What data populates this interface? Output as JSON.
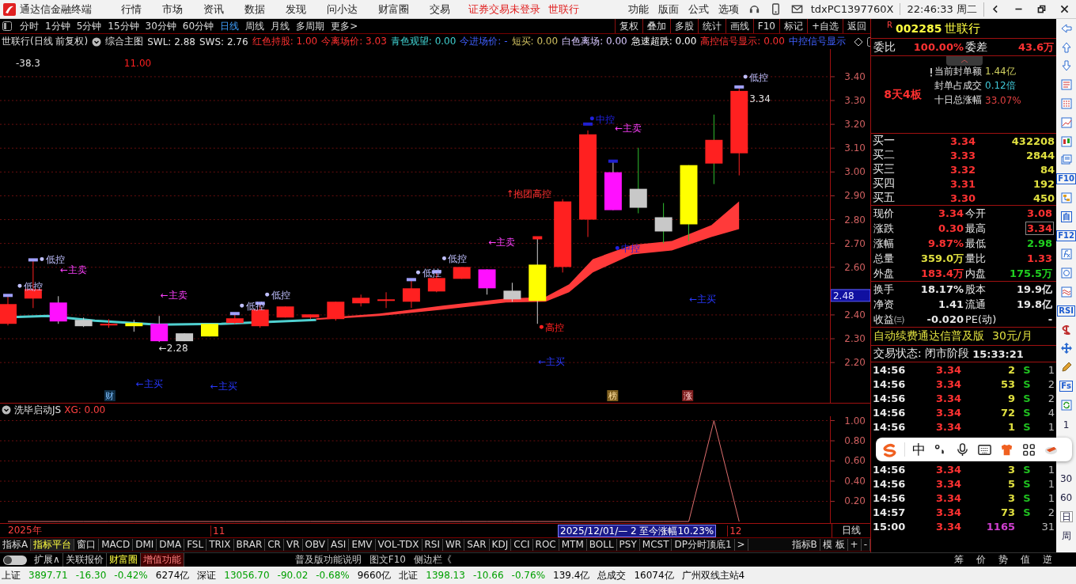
{
  "title_bar": {
    "app_name": "通达信金融终端",
    "menus": [
      "行情",
      "市场",
      "资讯",
      "数据",
      "发现",
      "问小达",
      "财富圈",
      "交易"
    ],
    "notice": "证券交易未登录",
    "notice_stock": "世联行",
    "right_menus": [
      "功能",
      "版面",
      "公式",
      "选项"
    ],
    "user_id": "tdxPC1397760X",
    "clock": "22:46:33 周二"
  },
  "period_tabs": [
    {
      "label": "分时",
      "selected": false
    },
    {
      "label": "1分钟",
      "selected": false
    },
    {
      "label": "5分钟",
      "selected": false
    },
    {
      "label": "15分钟",
      "selected": false
    },
    {
      "label": "30分钟",
      "selected": false
    },
    {
      "label": "60分钟",
      "selected": false
    },
    {
      "label": "日线",
      "selected": true
    },
    {
      "label": "周线",
      "selected": false
    },
    {
      "label": "月线",
      "selected": false
    },
    {
      "label": "多周期",
      "selected": false
    },
    {
      "label": "更多>",
      "selected": false
    }
  ],
  "chart_buttons": [
    "复权",
    "叠加",
    "多股",
    "统计",
    "画线",
    "F10",
    "标记",
    "+自选",
    "返回"
  ],
  "info_line": {
    "title": "世联行(日线 前复权)",
    "indicator": "综合主图",
    "items": [
      {
        "text": "SWL: 2.88",
        "kind": "plain"
      },
      {
        "text": "SWS: 2.76",
        "kind": "plain"
      },
      {
        "text": "红色持股: 1.00",
        "kind": "red"
      },
      {
        "text": "今离场价: 3.03",
        "kind": "red"
      },
      {
        "text": "青色观望: 0.00",
        "kind": "cyan"
      },
      {
        "text": "今进场价: -",
        "kind": "blue"
      },
      {
        "text": "短买: 0.00",
        "kind": "tan"
      },
      {
        "text": "白色离场: 0.00",
        "kind": "lavender"
      },
      {
        "text": "急速超跌: 0.00",
        "kind": "white"
      },
      {
        "text": "高控信号显示: 0.00",
        "kind": "red"
      },
      {
        "text": "中控信号显示",
        "kind": "blue"
      }
    ]
  },
  "main_chart": {
    "header_values": [
      "-38.3",
      "11.00"
    ],
    "y_labels": [
      "3.40",
      "3.30",
      "3.20",
      "3.10",
      "3.00",
      "2.90",
      "2.80",
      "2.70",
      "2.60",
      "2.40",
      "2.30",
      "2.20"
    ],
    "price_tag": "2.48",
    "annotations": [
      {
        "text": "低控",
        "kind": "low"
      },
      {
        "text": "低控",
        "kind": "low"
      },
      {
        "text": "←主卖",
        "kind": "sell"
      },
      {
        "text": "←主卖",
        "kind": "sell"
      },
      {
        "text": "←2.28",
        "kind": "price"
      },
      {
        "text": "←主买",
        "kind": "buy"
      },
      {
        "text": "←主买",
        "kind": "buy"
      },
      {
        "text": "低控",
        "kind": "low"
      },
      {
        "text": "低控",
        "kind": "low"
      },
      {
        "text": "低控",
        "kind": "low"
      },
      {
        "text": "低控",
        "kind": "low"
      },
      {
        "text": "←主卖",
        "kind": "sell"
      },
      {
        "text": "高控",
        "kind": "high"
      },
      {
        "text": "←主买",
        "kind": "buy"
      },
      {
        "text": "↑抱团高控",
        "kind": "hug"
      },
      {
        "text": "中控",
        "kind": "mid"
      },
      {
        "text": "←主卖",
        "kind": "sell"
      },
      {
        "text": "中控",
        "kind": "mid"
      },
      {
        "text": "←主买",
        "kind": "buy"
      },
      {
        "text": "低控",
        "kind": "low"
      },
      {
        "text": "3.34",
        "kind": "price"
      }
    ],
    "markers": [
      {
        "text": "财",
        "kind": "finance"
      },
      {
        "text": "榜",
        "kind": "rank"
      },
      {
        "text": "涨",
        "kind": "rise"
      }
    ]
  },
  "indicator": {
    "name": "洗毕启动JS",
    "reading": "XG: 0.00",
    "chart_data": {
      "type": "line",
      "grid": true,
      "ylim": [
        0,
        1.02
      ],
      "yticks": [
        {
          "value": 0.2,
          "label": "0.20"
        },
        {
          "value": 0.4,
          "label": "0.40"
        },
        {
          "value": 0.6,
          "label": "0.60"
        },
        {
          "value": 0.8,
          "label": "0.80"
        },
        {
          "value": 1.0,
          "label": "1.00"
        }
      ],
      "series": [
        {
          "color": "#e07070",
          "values": [
            0,
            0,
            0,
            0,
            0,
            0,
            0,
            0,
            0,
            0,
            0,
            0,
            0,
            0,
            0,
            0,
            0,
            0,
            0,
            0,
            0,
            0,
            0,
            0,
            0,
            0,
            0,
            0,
            1,
            0
          ]
        }
      ]
    }
  },
  "date_axis": {
    "year": "2025年",
    "month_1": "11",
    "range": "2025/12/01/— 2 至今涨幅10.23%",
    "month_2": "12",
    "period": "日线"
  },
  "indicator_tabs": [
    {
      "label": "指标A",
      "selected": false
    },
    {
      "label": "指标平台",
      "selected": true
    },
    {
      "label": "窗口",
      "selected": false
    },
    {
      "label": "MACD",
      "selected": false
    },
    {
      "label": "DMI",
      "selected": false
    },
    {
      "label": "DMA",
      "selected": false
    },
    {
      "label": "FSL",
      "selected": false
    },
    {
      "label": "TRIX",
      "selected": false
    },
    {
      "label": "BRAR",
      "selected": false
    },
    {
      "label": "CR",
      "selected": false
    },
    {
      "label": "VR",
      "selected": false
    },
    {
      "label": "OBV",
      "selected": false
    },
    {
      "label": "ASI",
      "selected": false
    },
    {
      "label": "EMV",
      "selected": false
    },
    {
      "label": "VOL-TDX",
      "selected": false
    },
    {
      "label": "RSI",
      "selected": false
    },
    {
      "label": "WR",
      "selected": false
    },
    {
      "label": "SAR",
      "selected": false
    },
    {
      "label": "KDJ",
      "selected": false
    },
    {
      "label": "CCI",
      "selected": false
    },
    {
      "label": "ROC",
      "selected": false
    },
    {
      "label": "MTM",
      "selected": false
    },
    {
      "label": "BOLL",
      "selected": false
    },
    {
      "label": "PSY",
      "selected": false
    },
    {
      "label": "MCST",
      "selected": false
    },
    {
      "label": "DP分时顶底1",
      "selected": false
    }
  ],
  "indicator_tabs_right": [
    "指标B",
    "模 板",
    "+",
    "-"
  ],
  "scroll_arrow": ">",
  "extra_bar": {
    "toggle_on": false,
    "buttons": [
      {
        "label": "扩展∧",
        "kind": "plain"
      },
      {
        "label": "关联报价",
        "kind": "plain"
      },
      {
        "label": "财富圈",
        "kind": "yellow"
      },
      {
        "label": "增值功能",
        "kind": "red"
      }
    ],
    "links": [
      "普及版功能说明",
      "图文F10",
      "侧边栏《"
    ],
    "panel_tabs": [
      "筹",
      "价",
      "势",
      "值",
      "逆"
    ]
  },
  "quote": {
    "code": "002285",
    "name": "世联行",
    "flag": "R",
    "order_ratio_label": "委比",
    "order_ratio": "100.00%",
    "order_diff_label": "委差",
    "order_diff": "43.6万",
    "streak": "8天4板",
    "seal": [
      {
        "label": "当前封单额",
        "value": "1.44亿",
        "color": "#d0d060"
      },
      {
        "label": "封单占成交",
        "value": "0.12倍",
        "color": "#40c8d8"
      },
      {
        "label": "十日总涨幅",
        "value": "33.07%",
        "color": "#e04040"
      }
    ],
    "bids": [
      {
        "label": "买一",
        "price": "3.34",
        "volume": "432208"
      },
      {
        "label": "买二",
        "price": "3.33",
        "volume": "2844"
      },
      {
        "label": "买三",
        "price": "3.32",
        "volume": "84"
      },
      {
        "label": "买四",
        "price": "3.31",
        "volume": "192"
      },
      {
        "label": "买五",
        "price": "3.30",
        "volume": "450"
      }
    ],
    "stats": [
      {
        "label": "现价",
        "value": "3.34",
        "kind": "up",
        "boxed": false
      },
      {
        "label": "今开",
        "value": "3.08",
        "kind": "up",
        "boxed": false
      },
      {
        "label": "涨跌",
        "value": "0.30",
        "kind": "up",
        "boxed": false
      },
      {
        "label": "最高",
        "value": "3.34",
        "kind": "up",
        "boxed": true
      },
      {
        "label": "涨幅",
        "value": "9.87%",
        "kind": "up",
        "boxed": false
      },
      {
        "label": "最低",
        "value": "2.98",
        "kind": "down",
        "boxed": false
      },
      {
        "label": "总量",
        "value": "359.0万",
        "kind": "volume",
        "boxed": false
      },
      {
        "label": "量比",
        "value": "1.33",
        "kind": "up",
        "boxed": false
      },
      {
        "label": "外盘",
        "value": "183.4万",
        "kind": "up",
        "boxed": false
      },
      {
        "label": "内盘",
        "value": "175.5万",
        "kind": "down",
        "boxed": false
      }
    ],
    "fundamentals": [
      {
        "label": "换手",
        "value": "18.17%"
      },
      {
        "label": "股本",
        "value": "19.9亿"
      },
      {
        "label": "净资",
        "value": "1.41"
      },
      {
        "label": "流通",
        "value": "19.8亿"
      },
      {
        "label": "收益㈢",
        "value": "-0.020"
      },
      {
        "label": "PE(动)",
        "value": "-"
      }
    ],
    "promo": "自动续费通达信普及版",
    "promo_price": "30元/月",
    "status_label": "交易状态: 闭市阶段",
    "status_time": "15:33:21",
    "trades": [
      {
        "time": "14:56",
        "price": "3.34",
        "volume": "2",
        "side": "S",
        "count": "1",
        "kind": "trade"
      },
      {
        "time": "14:56",
        "price": "3.34",
        "volume": "53",
        "side": "S",
        "count": "2",
        "kind": "trade"
      },
      {
        "time": "14:56",
        "price": "3.34",
        "volume": "9",
        "side": "S",
        "count": "2",
        "kind": "trade"
      },
      {
        "time": "14:56",
        "price": "3.34",
        "volume": "72",
        "side": "S",
        "count": "4",
        "kind": "trade"
      },
      {
        "time": "14:56",
        "price": "3.34",
        "volume": "1",
        "side": "S",
        "count": "1",
        "kind": "trade"
      },
      {
        "time": "14:56",
        "price": "3.34",
        "volume": "3",
        "side": "S",
        "count": "1",
        "kind": "trade"
      },
      {
        "time": "14:56",
        "price": "3.34",
        "volume": "5",
        "side": "S",
        "count": "1",
        "kind": "trade"
      },
      {
        "time": "14:56",
        "price": "3.34",
        "volume": "3",
        "side": "S",
        "count": "1",
        "kind": "trade"
      },
      {
        "time": "14:57",
        "price": "3.34",
        "volume": "73",
        "side": "S",
        "count": "2",
        "kind": "trade"
      },
      {
        "time": "15:00",
        "price": "3.34",
        "volume": "1165",
        "count": "31",
        "kind": "auction"
      }
    ]
  },
  "side_toolbar": [
    {
      "kind": "icon"
    },
    {
      "kind": "icon"
    },
    {
      "kind": "icon"
    },
    {
      "kind": "icon"
    },
    {
      "kind": "icon"
    },
    {
      "kind": "icon"
    },
    {
      "kind": "icon"
    },
    {
      "kind": "icon"
    },
    {
      "kind": "text",
      "label": "F10"
    },
    {
      "kind": "icon"
    },
    {
      "kind": "text",
      "label": "自"
    },
    {
      "kind": "text",
      "label": "F12"
    },
    {
      "kind": "icon"
    },
    {
      "kind": "icon"
    },
    {
      "kind": "icon"
    },
    {
      "kind": "text",
      "label": "RSI"
    },
    {
      "kind": "icon"
    },
    {
      "kind": "icon"
    },
    {
      "kind": "icon"
    },
    {
      "kind": "text",
      "label": "Fs"
    },
    {
      "kind": "icon"
    }
  ],
  "period_shortcuts": [
    {
      "label": "1",
      "selected": false
    },
    {
      "label": "30",
      "selected": false
    },
    {
      "label": "60",
      "selected": false
    },
    {
      "label": "日",
      "selected": true
    },
    {
      "label": "周",
      "selected": false
    }
  ],
  "ime_bar": {
    "mode": "中"
  },
  "status_bar": [
    {
      "text": "上证",
      "kind": "name"
    },
    {
      "text": "3897.71",
      "kind": "down"
    },
    {
      "text": "-16.30",
      "kind": "down"
    },
    {
      "text": "-0.42%",
      "kind": "down"
    },
    {
      "text": "6274亿",
      "kind": "amount"
    },
    {
      "text": "深证",
      "kind": "name"
    },
    {
      "text": "13056.70",
      "kind": "down"
    },
    {
      "text": "-90.02",
      "kind": "down"
    },
    {
      "text": "-0.68%",
      "kind": "down"
    },
    {
      "text": "9660亿",
      "kind": "amount"
    },
    {
      "text": "北证",
      "kind": "name"
    },
    {
      "text": "1398.13",
      "kind": "down"
    },
    {
      "text": "-10.66",
      "kind": "down"
    },
    {
      "text": "-0.76%",
      "kind": "down"
    },
    {
      "text": "139.4亿",
      "kind": "amount"
    },
    {
      "text": "总成交",
      "kind": "name"
    },
    {
      "text": "16074亿",
      "kind": "amount"
    },
    {
      "text": "广州双线主站4",
      "kind": "name"
    }
  ]
}
